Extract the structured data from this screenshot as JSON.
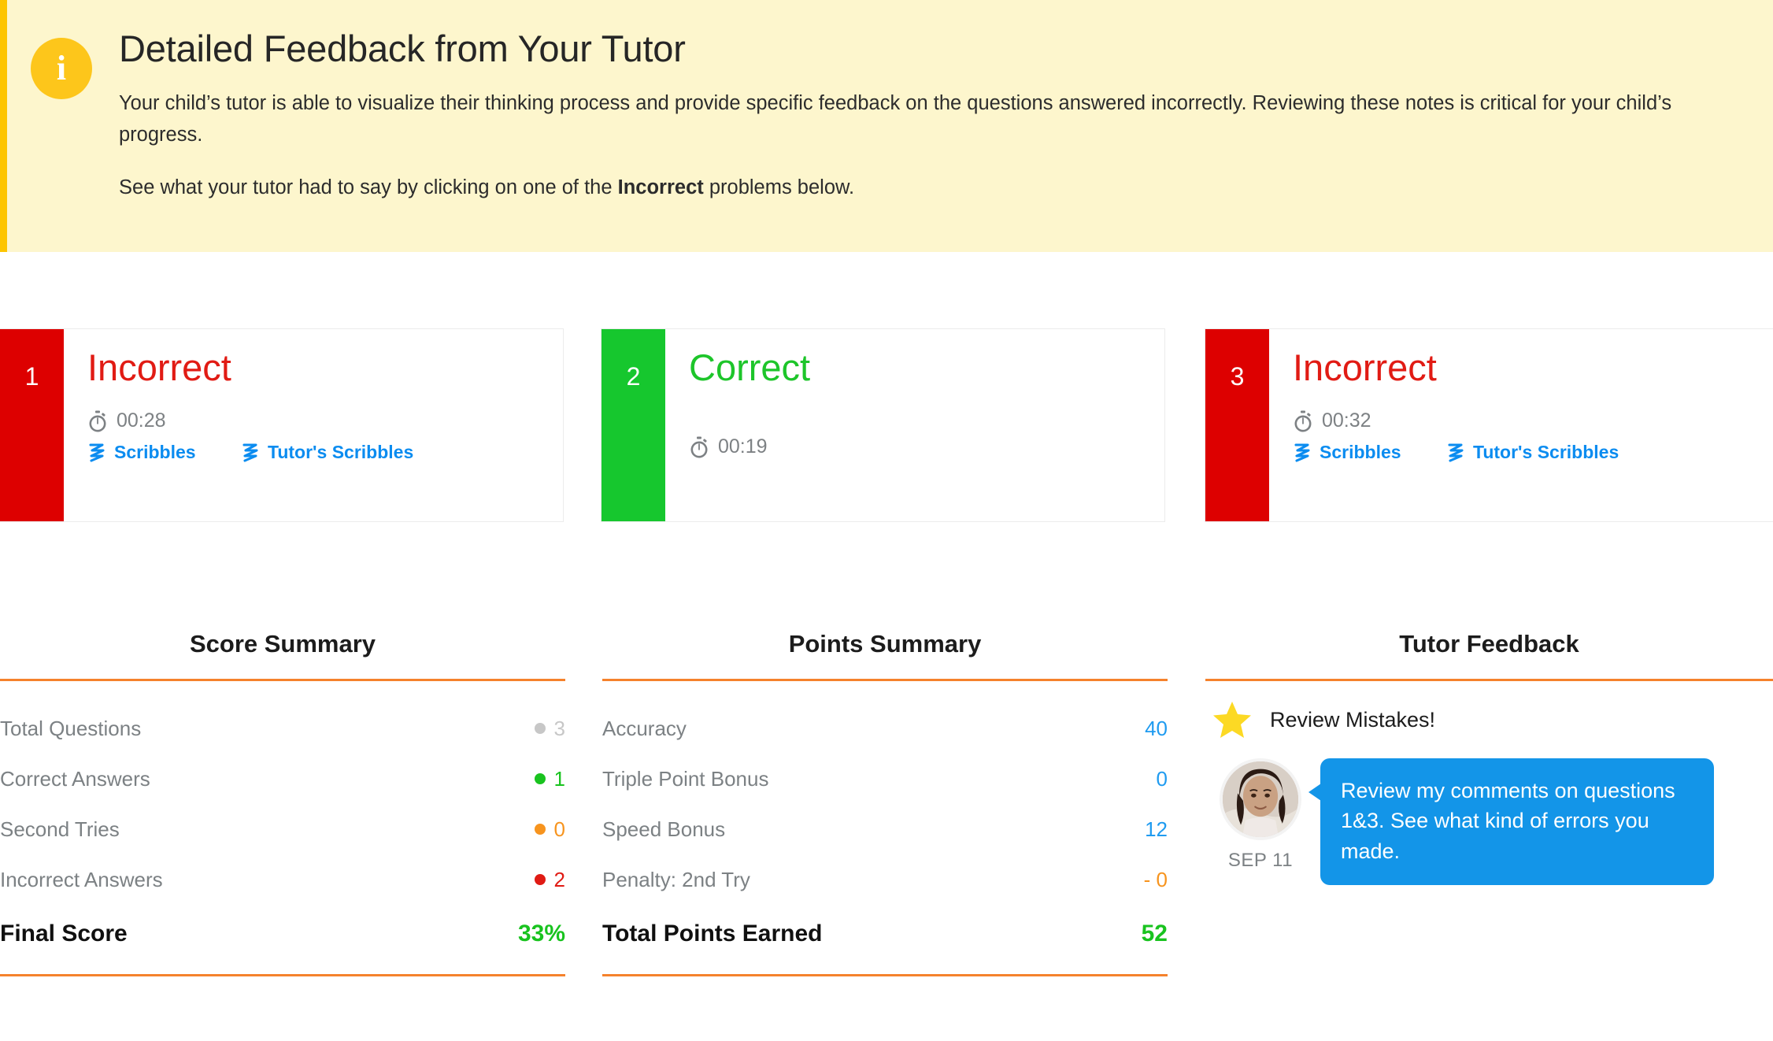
{
  "banner": {
    "icon": "info-icon",
    "title": "Detailed Feedback from Your Tutor",
    "paragraph1": "Your child’s tutor is able to visualize their thinking process and provide specific feedback on the questions answered incorrectly. Reviewing these notes is critical for your child’s progress.",
    "paragraph2_before": "See what your tutor had to say by clicking on one of the ",
    "paragraph2_bold": "Incorrect",
    "paragraph2_after": " problems below.",
    "accent_border": "#fdc500",
    "background": "#fdf6cd"
  },
  "problems": [
    {
      "number": "1",
      "status": "Incorrect",
      "status_type": "incorrect",
      "time": "00:28",
      "badge_color": "#dd0000",
      "links": [
        {
          "label": "Scribbles",
          "icon": "scribble-icon"
        },
        {
          "label": "Tutor's Scribbles",
          "icon": "scribble-icon"
        }
      ]
    },
    {
      "number": "2",
      "status": "Correct",
      "status_type": "correct",
      "time": "00:19",
      "badge_color": "#16c72e",
      "links": []
    },
    {
      "number": "3",
      "status": "Incorrect",
      "status_type": "incorrect",
      "time": "00:32",
      "badge_color": "#dd0000",
      "links": [
        {
          "label": "Scribbles",
          "icon": "scribble-icon"
        },
        {
          "label": "Tutor's Scribbles",
          "icon": "scribble-icon"
        }
      ]
    }
  ],
  "score_summary": {
    "title": "Score Summary",
    "rows": [
      {
        "label": "Total Questions",
        "value": "3",
        "dot": "#c7c7c7",
        "value_color": "#c7c7c7"
      },
      {
        "label": "Correct Answers",
        "value": "1",
        "dot": "#19c31f",
        "value_color": "#19c31f"
      },
      {
        "label": "Second Tries",
        "value": "0",
        "dot": "#f7941e",
        "value_color": "#f7941e"
      },
      {
        "label": "Incorrect Answers",
        "value": "2",
        "dot": "#e01b14",
        "value_color": "#e01b14"
      }
    ],
    "total_label": "Final Score",
    "total_value": "33%",
    "total_color": "#19c31f"
  },
  "points_summary": {
    "title": "Points Summary",
    "rows": [
      {
        "label": "Accuracy",
        "value": "40",
        "value_color": "#1f9bf0"
      },
      {
        "label": "Triple Point Bonus",
        "value": "0",
        "value_color": "#1f9bf0"
      },
      {
        "label": "Speed Bonus",
        "value": "12",
        "value_color": "#1f9bf0"
      },
      {
        "label": "Penalty: 2nd Try",
        "value": "- 0",
        "value_color": "#f7941e"
      }
    ],
    "total_label": "Total Points Earned",
    "total_value": "52",
    "total_color": "#19c31f"
  },
  "tutor_feedback": {
    "title": "Tutor Feedback",
    "star_icon": "star-icon",
    "headline": "Review Mistakes!",
    "message": "Review my comments on questions 1&3. See what kind of errors you made.",
    "date": "SEP 11",
    "bubble_color": "#1395e8"
  }
}
